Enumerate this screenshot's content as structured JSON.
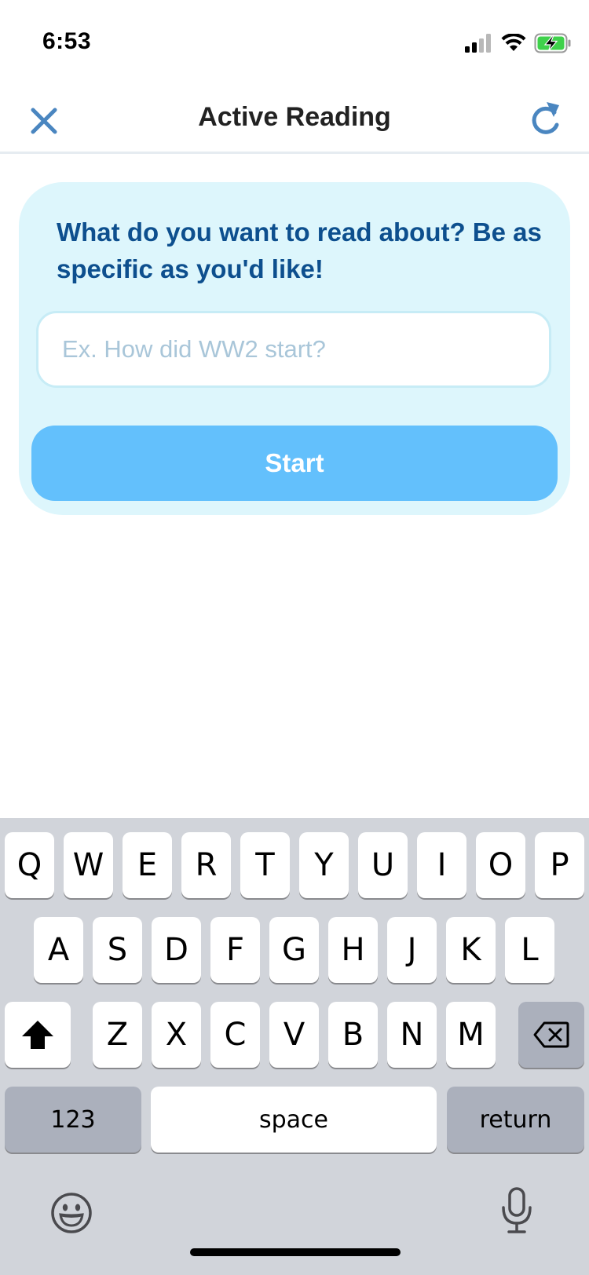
{
  "status_bar": {
    "time": "6:53"
  },
  "header": {
    "title": "Active Reading",
    "close_icon": "close-icon",
    "refresh_icon": "refresh-icon"
  },
  "card": {
    "prompt": "What do you want to read about? Be as specific as you'd like!",
    "input_placeholder": "Ex. How did WW2 start?",
    "input_value": "",
    "start_label": "Start"
  },
  "keyboard": {
    "row1": [
      "Q",
      "W",
      "E",
      "R",
      "T",
      "Y",
      "U",
      "I",
      "O",
      "P"
    ],
    "row2": [
      "A",
      "S",
      "D",
      "F",
      "G",
      "H",
      "J",
      "K",
      "L"
    ],
    "row3": [
      "Z",
      "X",
      "C",
      "V",
      "B",
      "N",
      "M"
    ],
    "numbers_label": "123",
    "space_label": "space",
    "return_label": "return"
  },
  "colors": {
    "accent": "#63c0fc",
    "card_bg": "#ddf6fc",
    "prompt_text": "#0d4f8e",
    "icon": "#4a86c0"
  }
}
